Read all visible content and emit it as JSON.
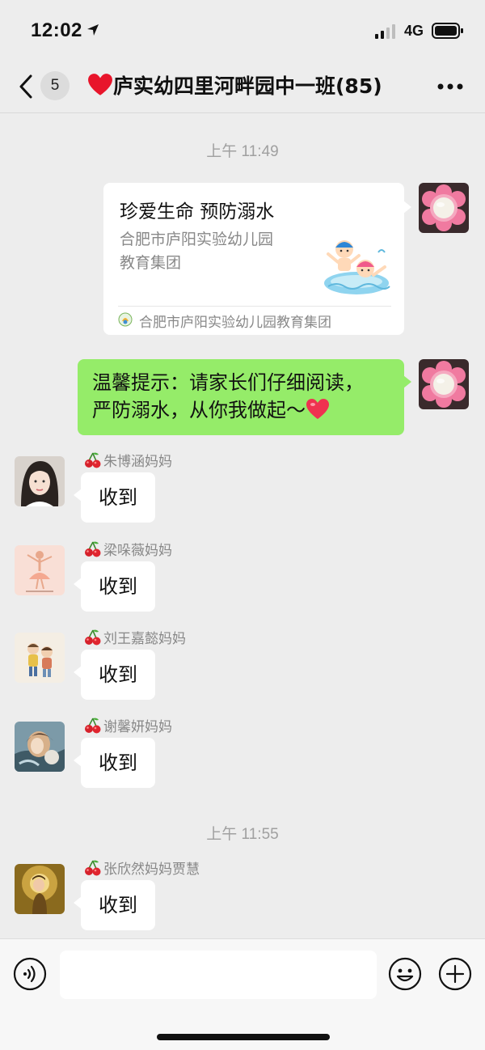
{
  "status_bar": {
    "time": "12:02",
    "network": "4G"
  },
  "nav": {
    "back_badge": "5",
    "title": "庐实幼四里河畔园中一班(85)"
  },
  "messages": {
    "timestamp_1": "上午 11:49",
    "card": {
      "title": "珍爱生命  预防溺水",
      "description_line1": "合肥市庐阳实验幼儿园",
      "description_line2": "教育集团",
      "source": "合肥市庐阳实验幼儿园教育集团"
    },
    "notice": {
      "line1": "温馨提示：请家长们仔细阅读，",
      "line2": "严防溺水，从你我做起～"
    },
    "replies": [
      {
        "sender": "朱博涵妈妈",
        "text": "收到"
      },
      {
        "sender": "梁哚薇妈妈",
        "text": "收到"
      },
      {
        "sender": "刘王嘉懿妈妈",
        "text": "收到"
      },
      {
        "sender": "谢馨妍妈妈",
        "text": "收到"
      }
    ],
    "timestamp_2": "上午 11:55",
    "last_reply": {
      "sender": "张欣然妈妈贾慧",
      "text": "收到"
    }
  },
  "input_bar": {
    "placeholder": ""
  },
  "colors": {
    "background": "#ededed",
    "sent_bubble": "#95ec69",
    "received_bubble": "#ffffff",
    "meta_text": "#888888"
  }
}
